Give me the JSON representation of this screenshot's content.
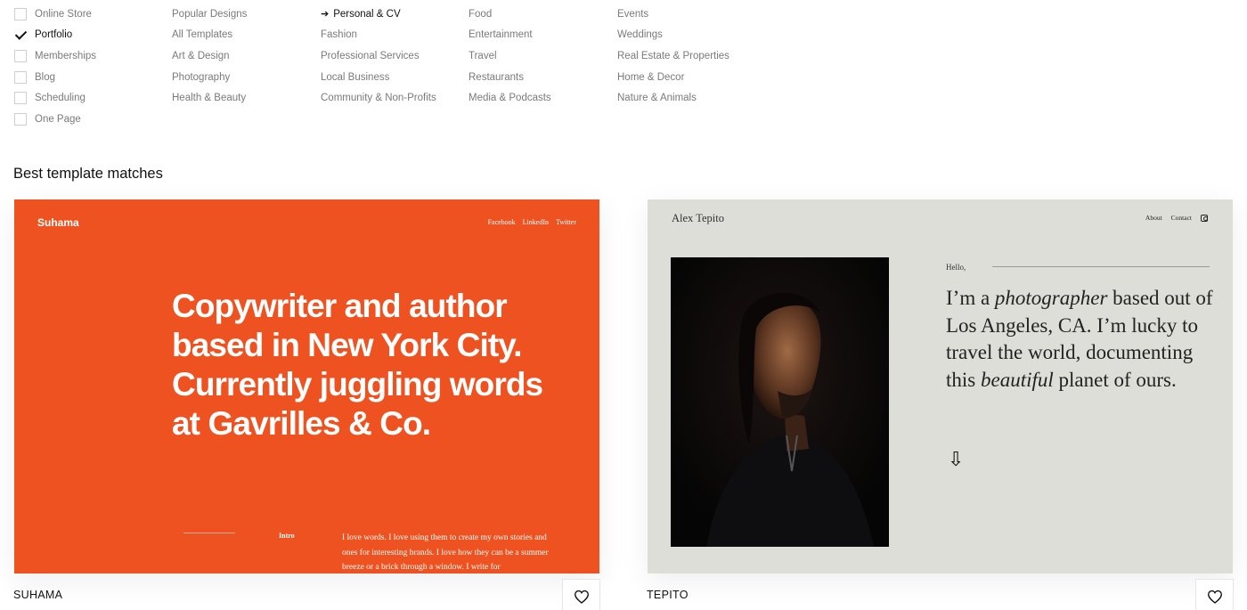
{
  "features": [
    {
      "label": "Online Store",
      "checked": false
    },
    {
      "label": "Portfolio",
      "checked": true
    },
    {
      "label": "Memberships",
      "checked": false
    },
    {
      "label": "Blog",
      "checked": false
    },
    {
      "label": "Scheduling",
      "checked": false
    },
    {
      "label": "One Page",
      "checked": false
    }
  ],
  "categories": {
    "col1": [
      "Popular Designs",
      "All Templates",
      "Art & Design",
      "Photography",
      "Health & Beauty"
    ],
    "col2": [
      "Personal & CV",
      "Fashion",
      "Professional Services",
      "Local Business",
      "Community & Non-Profits"
    ],
    "col3": [
      "Food",
      "Entertainment",
      "Travel",
      "Restaurants",
      "Media & Podcasts"
    ],
    "col4": [
      "Events",
      "Weddings",
      "Real Estate & Properties",
      "Home & Decor",
      "Nature & Animals"
    ],
    "active": "Personal & CV",
    "active_icon": "arrow-right-icon"
  },
  "section_title": "Best template matches",
  "templates": [
    {
      "name": "SUHAMA",
      "preview": {
        "logo": "Suhama",
        "nav": [
          "Facebook",
          "LinkedIn",
          "Twitter"
        ],
        "headline": "Copywriter and author based in New York City. Currently juggling words at Gavrilles & Co.",
        "intro_label": "Intro",
        "body": "I love words. I love using them to create my own stories and ones for interesting brands. I love how they can be a summer breeze or a brick through a window. I write for",
        "bg_color": "#ee5220"
      },
      "favorite_icon": "heart-icon"
    },
    {
      "name": "TEPITO",
      "preview": {
        "site_name": "Alex Tepito",
        "nav": [
          "About",
          "Contact"
        ],
        "social_icon": "instagram-icon",
        "greeting": "Hello,",
        "intro_pre": "I’m a ",
        "intro_em1": "photographer",
        "intro_mid": " based out of Los Angeles, CA. I’m lucky to travel the world, documenting this ",
        "intro_em2": "beautiful",
        "intro_post": " planet of ours.",
        "down_icon": "arrow-down-icon",
        "bg_color": "#deded8"
      },
      "favorite_icon": "heart-icon"
    }
  ]
}
